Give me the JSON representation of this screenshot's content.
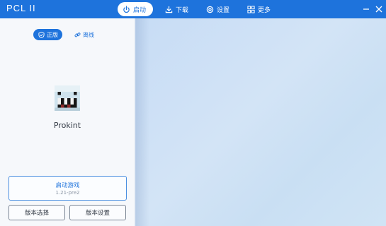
{
  "app": {
    "title": "PCL II"
  },
  "nav": [
    {
      "label": "启动",
      "icon": "power-icon",
      "active": true
    },
    {
      "label": "下载",
      "icon": "download-icon",
      "active": false
    },
    {
      "label": "设置",
      "icon": "settings-icon",
      "active": false
    },
    {
      "label": "更多",
      "icon": "grid-icon",
      "active": false
    }
  ],
  "window_controls": {
    "minimize": "minimize-icon",
    "close": "close-icon"
  },
  "mode_switch": {
    "online_label": "正版",
    "offline_label": "离线"
  },
  "profile": {
    "name": "Prokint"
  },
  "launch": {
    "label": "启动游戏",
    "version": "1.21-pre2"
  },
  "buttons": {
    "version_select": "版本选择",
    "version_settings": "版本设置"
  },
  "colors": {
    "accent": "#1e73dc",
    "panel_bg": "#f6f8fb",
    "background": "#c9dff3"
  }
}
